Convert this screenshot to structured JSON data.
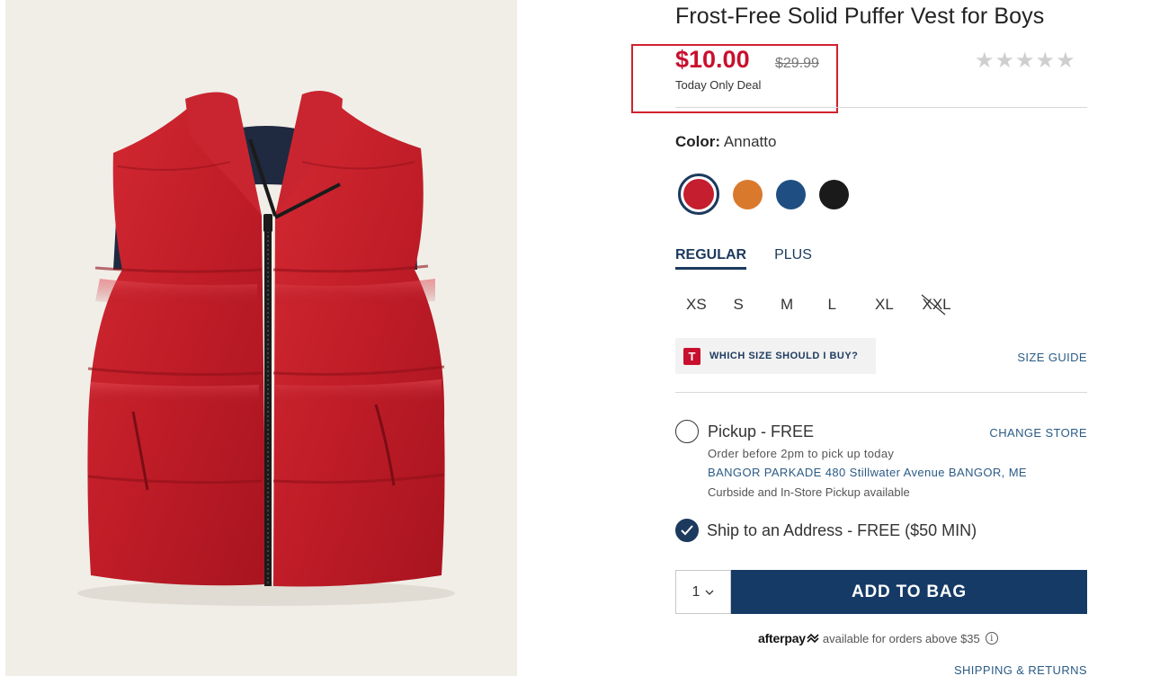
{
  "product": {
    "title": "Frost-Free Solid Puffer Vest for Boys",
    "price_sale": "$10.00",
    "price_original": "$29.99",
    "price_note": "Today Only Deal",
    "rating_stars": 0,
    "rating_max": 5
  },
  "colors": {
    "label": "Color:",
    "selected_name": "Annatto",
    "swatches": [
      {
        "name": "Annatto",
        "hex": "#c41e2f",
        "selected": true
      },
      {
        "name": "orange",
        "hex": "#d9792c",
        "selected": false
      },
      {
        "name": "navy",
        "hex": "#1f4f82",
        "selected": false
      },
      {
        "name": "black",
        "hex": "#1a1a1a",
        "selected": false
      }
    ]
  },
  "fit_tabs": [
    {
      "label": "REGULAR",
      "active": true
    },
    {
      "label": "PLUS",
      "active": false
    }
  ],
  "sizes": [
    {
      "label": "XS",
      "available": true
    },
    {
      "label": "S",
      "available": true
    },
    {
      "label": "M",
      "available": true
    },
    {
      "label": "L",
      "available": true
    },
    {
      "label": "XL",
      "available": true
    },
    {
      "label": "XXL",
      "available": false
    }
  ],
  "size_help": {
    "logo_letter": "T",
    "which_size": "WHICH SIZE SHOULD I BUY?",
    "size_guide": "SIZE GUIDE"
  },
  "pickup": {
    "title": "Pickup - FREE",
    "change_store": "CHANGE STORE",
    "order_before": "Order before 2pm to pick up today",
    "store": "BANGOR PARKADE 480 Stillwater Avenue  BANGOR, ME",
    "availability": "Curbside and In-Store Pickup available",
    "selected": false
  },
  "ship": {
    "title": "Ship to an Address - FREE ($50 MIN)",
    "selected": true
  },
  "cart": {
    "quantity": "1",
    "add_label": "ADD TO BAG"
  },
  "afterpay": {
    "brand": "afterpay",
    "text": "available for orders above $35",
    "info": "i"
  },
  "links": {
    "shipping_returns": "SHIPPING & RETURNS"
  },
  "theme": {
    "accent_navy": "#153a66",
    "sale_red": "#c8102e",
    "link_blue": "#2b5b85"
  }
}
